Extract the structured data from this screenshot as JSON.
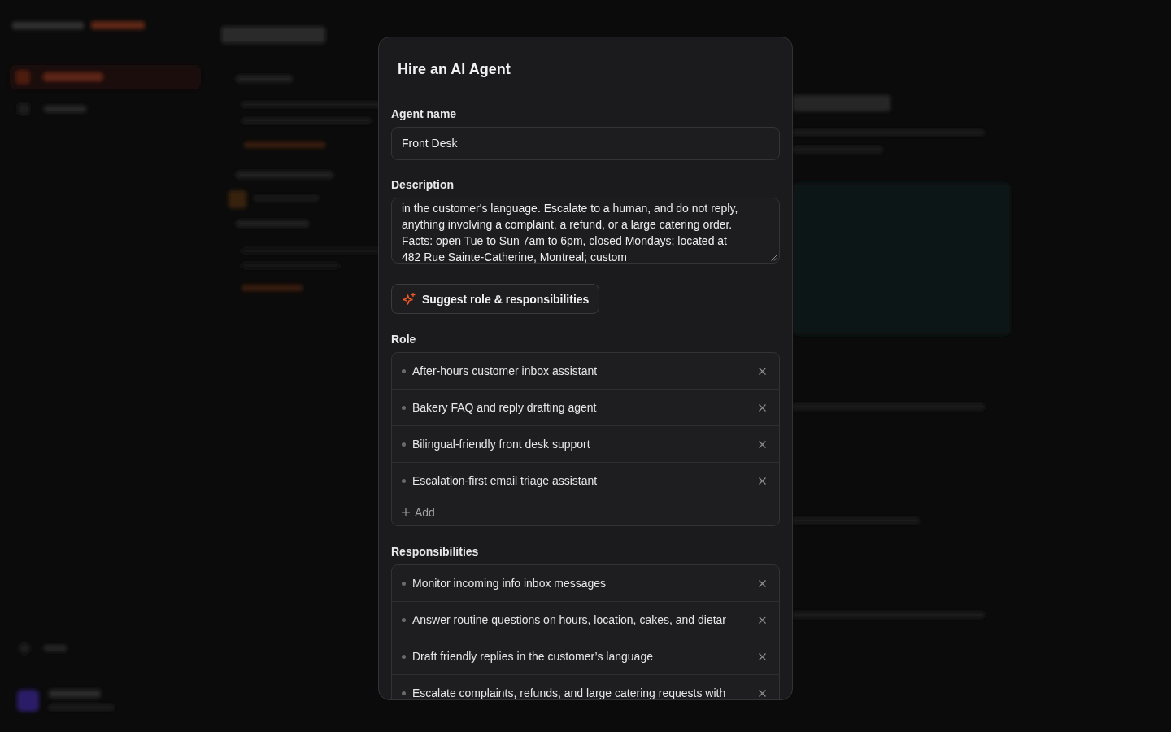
{
  "dialog": {
    "title": "Hire an AI Agent",
    "fields": [
      {
        "kind": "input",
        "label": "Agent name",
        "value": "Front Desk"
      },
      {
        "kind": "textarea",
        "label": "Description",
        "lines": [
          "in the customer's language. Escalate to a human, and do not reply,",
          "anything involving a complaint, a refund, or a large catering order.",
          "Facts: open Tue to Sun 7am to 6pm, closed Mondays; located at",
          "482 Rue Sainte-Catherine, Montreal; custom"
        ]
      }
    ],
    "suggest_button": {
      "label": "Suggest role & responsibilities"
    },
    "lists": [
      {
        "label": "Role",
        "items": [
          "After-hours customer inbox assistant",
          "Bakery FAQ and reply drafting agent",
          "Bilingual-friendly front desk support",
          "Escalation-first email triage assistant"
        ],
        "add_label": "Add"
      },
      {
        "label": "Responsibilities",
        "items": [
          "Monitor incoming info inbox messages",
          "Answer routine questions on hours, location, cakes, and dietar",
          "Draft friendly replies in the customer’s language",
          "Escalate complaints, refunds, and large catering requests with"
        ]
      }
    ]
  }
}
